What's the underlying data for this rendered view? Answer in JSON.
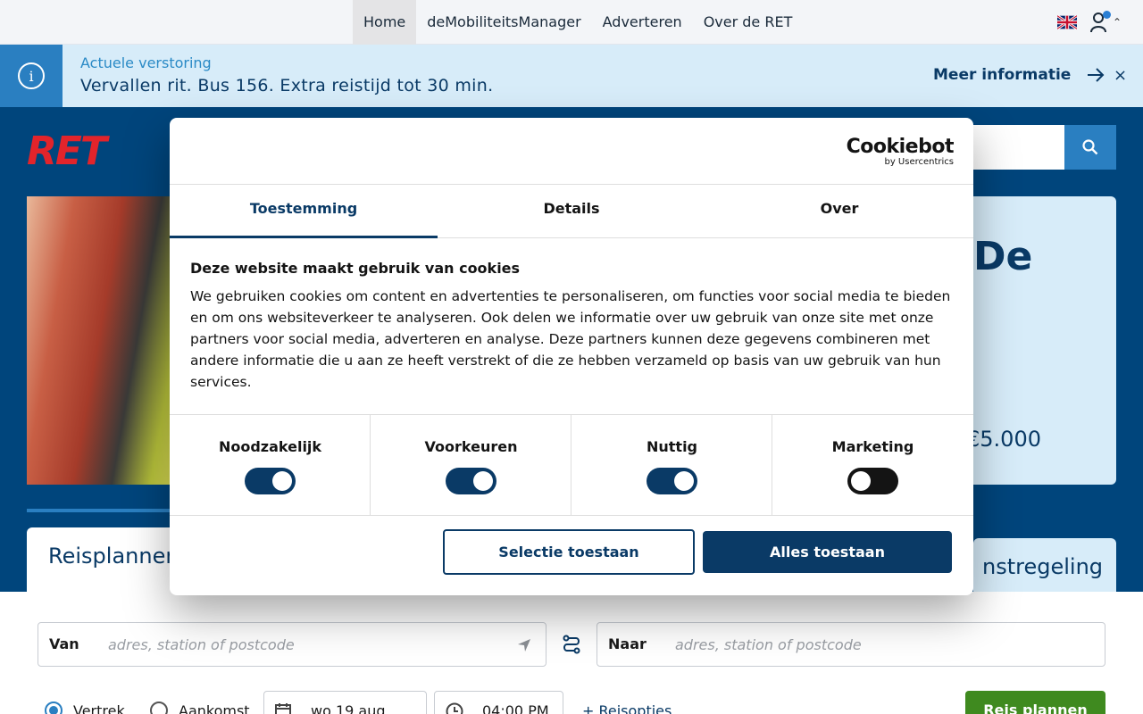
{
  "topnav": {
    "links": [
      "Home",
      "deMobiliteitsManager",
      "Adverteren",
      "Over de RET"
    ],
    "active_index": 0
  },
  "alert": {
    "label": "Actuele verstoring",
    "message": "Vervallen rit. Bus 156. Extra reistijd tot 30 min.",
    "more": "Meer informatie",
    "close": "×"
  },
  "logo": {
    "text": "RET"
  },
  "hero": {
    "title_fragment": "De",
    "amount_fragment": "€5.000"
  },
  "planner": {
    "tab_label": "Reisplanner",
    "right_tab_fragment": "nstregeling",
    "from_label": "Van",
    "from_placeholder": "adres, station of postcode",
    "to_label": "Naar",
    "to_placeholder": "adres, station of postcode",
    "radio_departure": "Vertrek",
    "radio_arrival": "Aankomst",
    "date": "wo 19 aug",
    "time": "04:00 PM",
    "options_link": "+ Reisopties",
    "submit": "Reis plannen"
  },
  "cookie": {
    "brand": "Cookiebot",
    "brand_sub": "by Usercentrics",
    "tabs": [
      "Toestemming",
      "Details",
      "Over"
    ],
    "active_tab": 0,
    "heading": "Deze website maakt gebruik van cookies",
    "body": "We gebruiken cookies om content en advertenties te personaliseren, om functies voor social media te bieden en om ons websiteverkeer te analyseren. Ook delen we informatie over uw gebruik van onze site met onze partners voor social media, adverteren en analyse. Deze partners kunnen deze gegevens combineren met andere informatie die u aan ze heeft verstrekt of die ze hebben verzameld op basis van uw gebruik van hun services.",
    "categories": [
      {
        "name": "Noodzakelijk",
        "enabled": true
      },
      {
        "name": "Voorkeuren",
        "enabled": true
      },
      {
        "name": "Nuttig",
        "enabled": true
      },
      {
        "name": "Marketing",
        "enabled": false
      }
    ],
    "btn_selection": "Selectie toestaan",
    "btn_all": "Alles toestaan"
  },
  "colors": {
    "brand_blue": "#00457c",
    "dark_blue": "#0a3a66",
    "light_blue": "#d7ecf9",
    "accent_blue": "#2a7fc1",
    "ret_red": "#e2242b",
    "green": "#3f8a1f"
  },
  "icons": [
    "info-icon",
    "arrow-right-icon",
    "close-icon",
    "search-icon",
    "uk-flag-icon",
    "user-icon",
    "chevron-up-icon",
    "location-arrow-icon",
    "swap-icon",
    "calendar-icon",
    "clock-icon"
  ]
}
